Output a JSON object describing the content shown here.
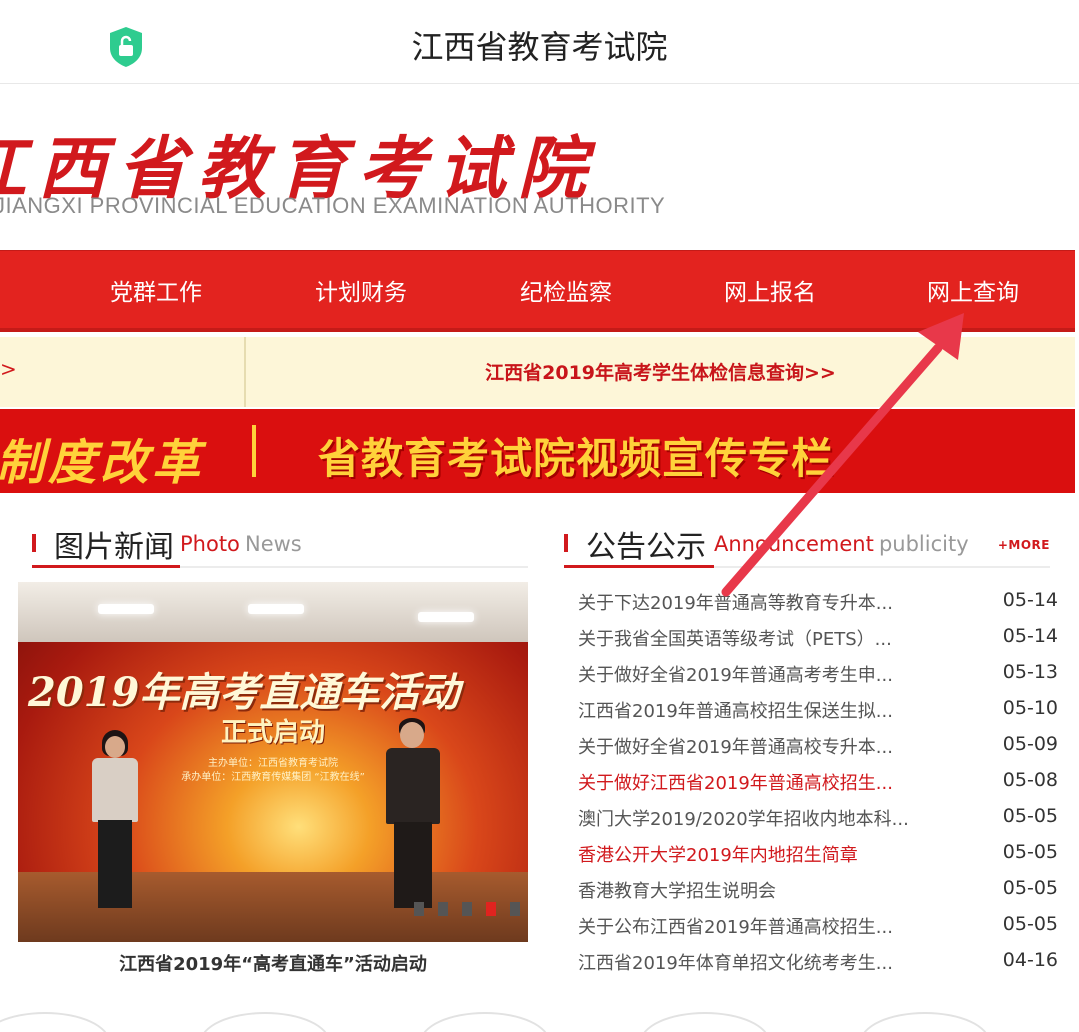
{
  "app_bar": {
    "title": "江西省教育考试院",
    "lock_icon": "shield-lock-icon"
  },
  "banner": {
    "calligraphy": "江西省教育考试院",
    "english": "JIANGXI PROVINCIAL EDUCATION EXAMINATION AUTHORITY"
  },
  "nav": {
    "items": [
      {
        "label": "党群工作"
      },
      {
        "label": "计划财务"
      },
      {
        "label": "纪检监察"
      },
      {
        "label": "网上报名"
      },
      {
        "label": "网上查询"
      }
    ]
  },
  "notice": {
    "left_tail": ">",
    "link": "江西省2019年高考学生体检信息查询>>"
  },
  "promo": {
    "left": "制度改革",
    "right": "省教育考试院视频宣传专栏"
  },
  "photo_news": {
    "title": "图片新闻",
    "en_a": "Photo",
    "en_b": "News",
    "image_headline": "2019年高考直通车活动",
    "image_sub": "正式启动",
    "image_line1": "主办单位：江西省教育考试院",
    "image_line2": "承办单位：江西教育传媒集团 “江教在线”",
    "caption": "江西省2019年“高考直通车”活动启动",
    "active_slide": 4,
    "slide_count": 5
  },
  "announcements": {
    "title": "公告公示",
    "en_a": "Announcement",
    "en_b": "publicity",
    "more": "+MORE",
    "items": [
      {
        "title": "关于下达2019年普通高等教育专升本...",
        "date": "05-14",
        "highlight": false
      },
      {
        "title": "关于我省全国英语等级考试（PETS）...",
        "date": "05-14",
        "highlight": false
      },
      {
        "title": "关于做好全省2019年普通高考考生申...",
        "date": "05-13",
        "highlight": false
      },
      {
        "title": "江西省2019年普通高校招生保送生拟...",
        "date": "05-10",
        "highlight": false
      },
      {
        "title": "关于做好全省2019年普通高校专升本...",
        "date": "05-09",
        "highlight": false
      },
      {
        "title": "关于做好江西省2019年普通高校招生...",
        "date": "05-08",
        "highlight": true
      },
      {
        "title": "澳门大学2019/2020学年招收内地本科...",
        "date": "05-05",
        "highlight": false
      },
      {
        "title": "香港公开大学2019年内地招生简章",
        "date": "05-05",
        "highlight": true
      },
      {
        "title": "香港教育大学招生说明会",
        "date": "05-05",
        "highlight": false
      },
      {
        "title": "关于公布江西省2019年普通高校招生...",
        "date": "05-05",
        "highlight": false
      },
      {
        "title": "江西省2019年体育单招文化统考考生...",
        "date": "04-16",
        "highlight": false
      }
    ]
  },
  "colors": {
    "brand_red": "#e3231f",
    "notice_bg": "#fdf6d8",
    "promo_gold": "#ffd23a",
    "arrow": "#e8384a"
  }
}
